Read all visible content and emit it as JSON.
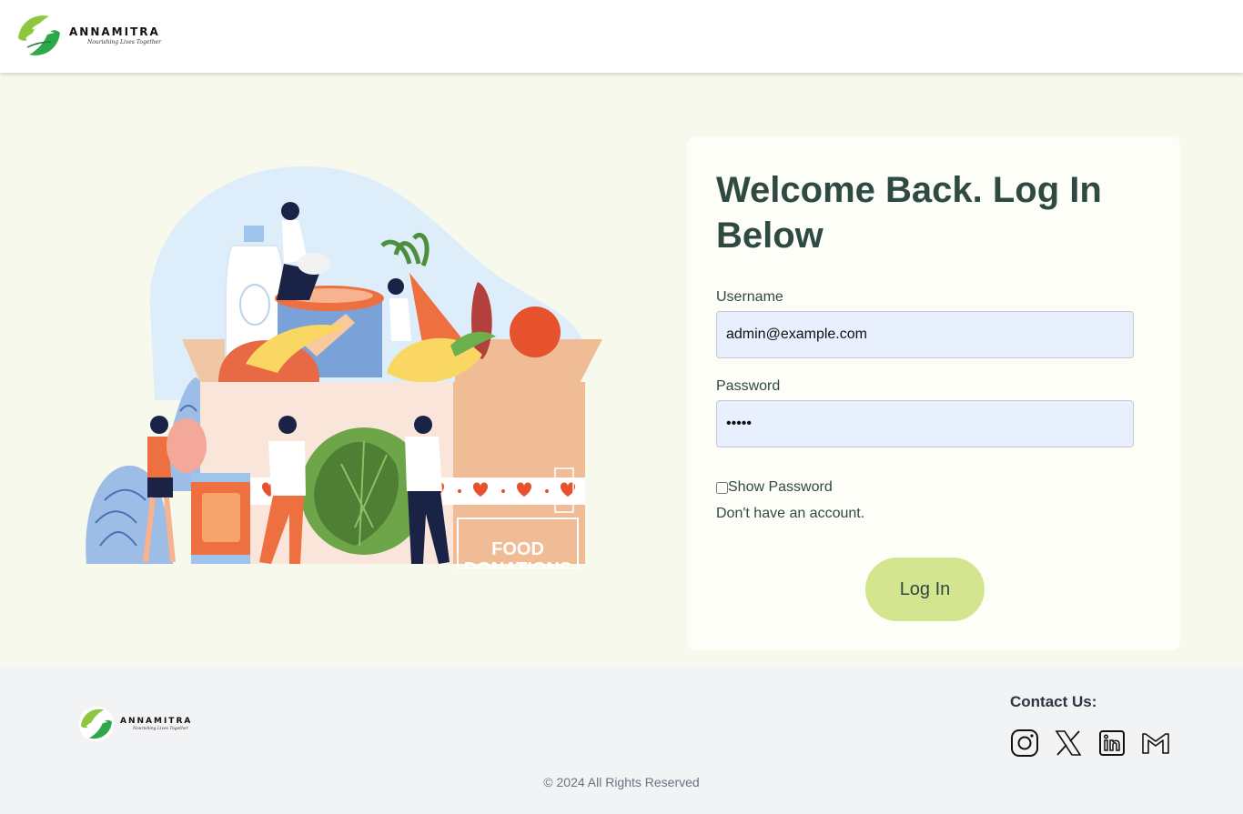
{
  "brand": {
    "name": "ANNAMITRA",
    "tagline": "Nourishing Lives Together"
  },
  "illustration": {
    "box_text_line1": "FOOD",
    "box_text_line2": "DONATIONS"
  },
  "login": {
    "title": "Welcome Back. Log In Below",
    "username_label": "Username",
    "username_value": "admin@example.com",
    "password_label": "Password",
    "password_value": "admin",
    "show_password_label": "Show Password",
    "show_password_checked": false,
    "signup_text": "Don't have an account.",
    "submit_label": "Log In"
  },
  "footer": {
    "contact_title": "Contact Us:",
    "social_icons": [
      "instagram-icon",
      "x-twitter-icon",
      "linkedin-icon",
      "gmail-icon"
    ],
    "copyright": "© 2024 All Rights Reserved"
  },
  "colors": {
    "header_bg": "#ffffff",
    "main_bg": "#f7f9ec",
    "card_bg": "#fdfef8",
    "title_text": "#2f4a43",
    "input_bg": "#e8f0fe",
    "button_bg": "#d4e58f",
    "footer_bg": "#f2f3f5"
  }
}
